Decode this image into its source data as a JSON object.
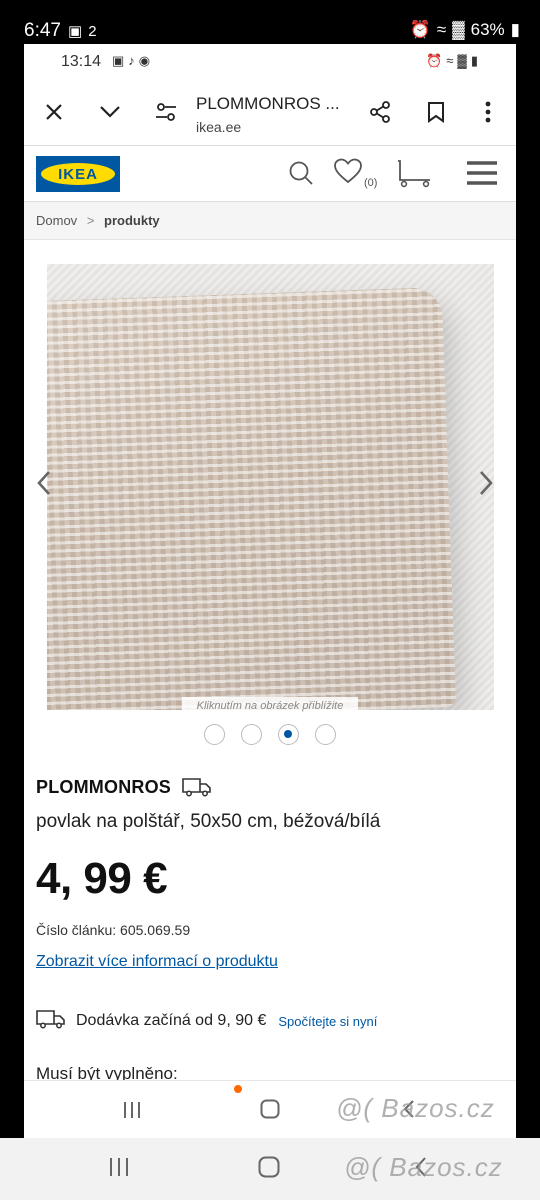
{
  "outer_status": {
    "time": "6:47",
    "badge": "2",
    "battery": "63%"
  },
  "inner_status": {
    "time": "13:14"
  },
  "browser": {
    "title": "PLOMMONROS ...",
    "domain": "ikea.ee",
    "icons": {
      "close": "close-icon",
      "expand": "chevron-down-icon",
      "settings": "site-settings-icon",
      "share": "share-icon",
      "bookmark": "bookmark-icon",
      "menu": "more-icon"
    }
  },
  "header": {
    "logo": "IKEA",
    "wishlist_count": "(0)"
  },
  "breadcrumb": {
    "home": "Domov",
    "separator": ">",
    "current": "produkty"
  },
  "gallery": {
    "zoom_hint": "Kliknutím na obrázek přiblížite",
    "dot_count": 4,
    "active_dot": 3
  },
  "product": {
    "name": "PLOMMONROS",
    "description": "povlak na polštář, 50x50 cm, béžová/bílá",
    "price": "4, 99 €",
    "article": "Číslo článku: 605.069.59",
    "more_info": "Zobrazit více informací o produktu",
    "delivery_text": "Dodávka začíná od 9, 90 €",
    "delivery_calc": "Spočítejte si nyní",
    "required_label": "Musí být vyplněno:"
  },
  "watermark": "@( Bazos.cz",
  "colors": {
    "ikea_blue": "#0058a3",
    "ikea_yellow": "#ffdb00",
    "link": "#0058a3"
  }
}
